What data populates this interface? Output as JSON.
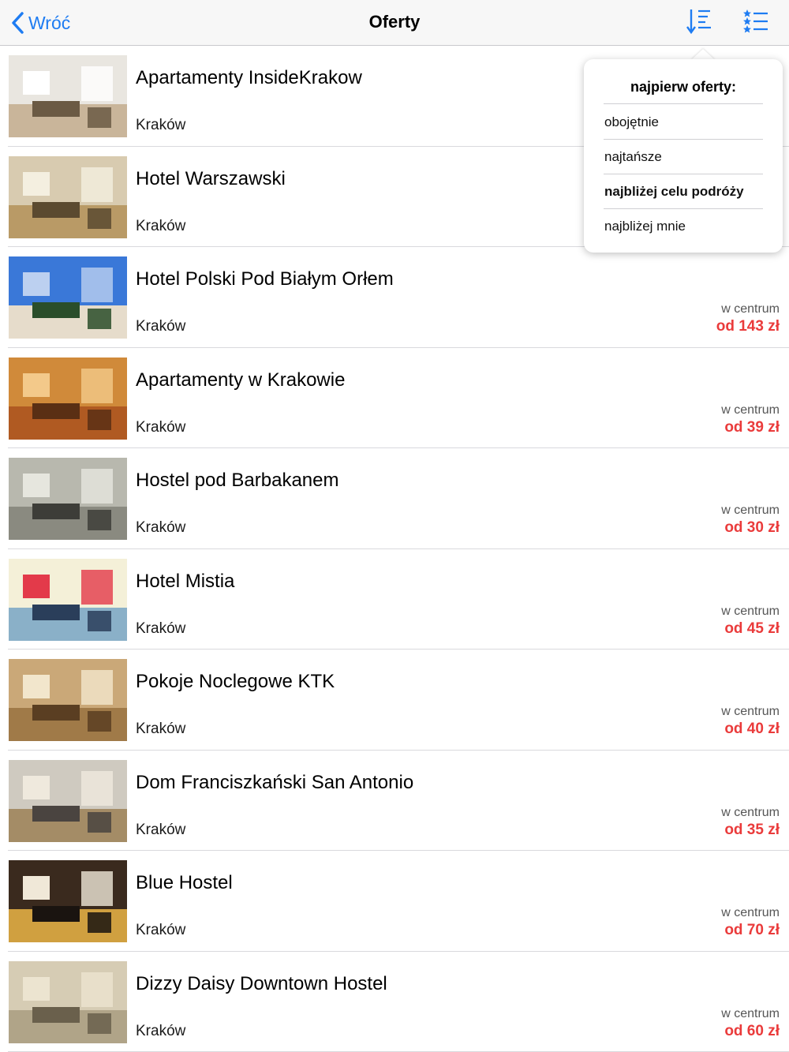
{
  "navbar": {
    "back_label": "Wróć",
    "title": "Oferty",
    "sort_icon": "sort-icon",
    "filter_icon": "star-list-icon",
    "accent": "#1e7cf2"
  },
  "sort_menu": {
    "title": "najpierw oferty:",
    "options": [
      "obojętnie",
      "najtańsze",
      "najbliżej celu podróży",
      "najbliżej mnie"
    ],
    "selected": "najbliżej celu podróży"
  },
  "price_color": "#ea3b3b",
  "offers": [
    {
      "name": "Apartamenty InsideKrakow",
      "city": "Kraków",
      "location": "",
      "price": ""
    },
    {
      "name": "Hotel Warszawski",
      "city": "Kraków",
      "location": "",
      "price": ""
    },
    {
      "name": "Hotel Polski Pod Białym Orłem",
      "city": "Kraków",
      "location": "w centrum",
      "price": "od 143 zł"
    },
    {
      "name": "Apartamenty w Krakowie",
      "city": "Kraków",
      "location": "w centrum",
      "price": "od 39 zł"
    },
    {
      "name": "Hostel pod Barbakanem",
      "city": "Kraków",
      "location": "w centrum",
      "price": "od 30 zł"
    },
    {
      "name": "Hotel Mistia",
      "city": "Kraków",
      "location": "w centrum",
      "price": "od 45 zł"
    },
    {
      "name": "Pokoje Noclegowe KTK",
      "city": "Kraków",
      "location": "w centrum",
      "price": "od 40 zł"
    },
    {
      "name": "Dom Franciszkański San Antonio",
      "city": "Kraków",
      "location": "w centrum",
      "price": "od 35 zł"
    },
    {
      "name": "Blue Hostel",
      "city": "Kraków",
      "location": "w centrum",
      "price": "od 70 zł"
    },
    {
      "name": "Dizzy Daisy Downtown Hostel",
      "city": "Kraków",
      "location": "w centrum",
      "price": "od 60 zł"
    }
  ]
}
